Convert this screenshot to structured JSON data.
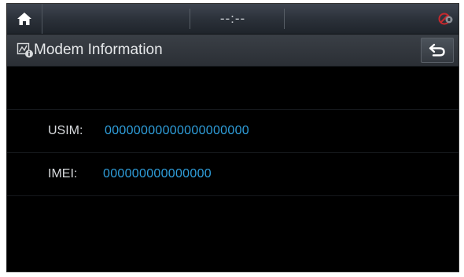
{
  "status_bar": {
    "time": "--:--",
    "home_icon": "home-icon",
    "status_icon": "mic-mute-status-icon"
  },
  "title_bar": {
    "title": "Modem Information",
    "title_icon": "modem-info-icon",
    "back_icon": "back-arrow-icon"
  },
  "info": {
    "usim": {
      "label": "USIM:",
      "value": "00000000000000000000"
    },
    "imei": {
      "label": "IMEI:",
      "value": "000000000000000"
    }
  },
  "colors": {
    "accent_value": "#2f9fdc",
    "status_icon_red": "#c8282d"
  }
}
